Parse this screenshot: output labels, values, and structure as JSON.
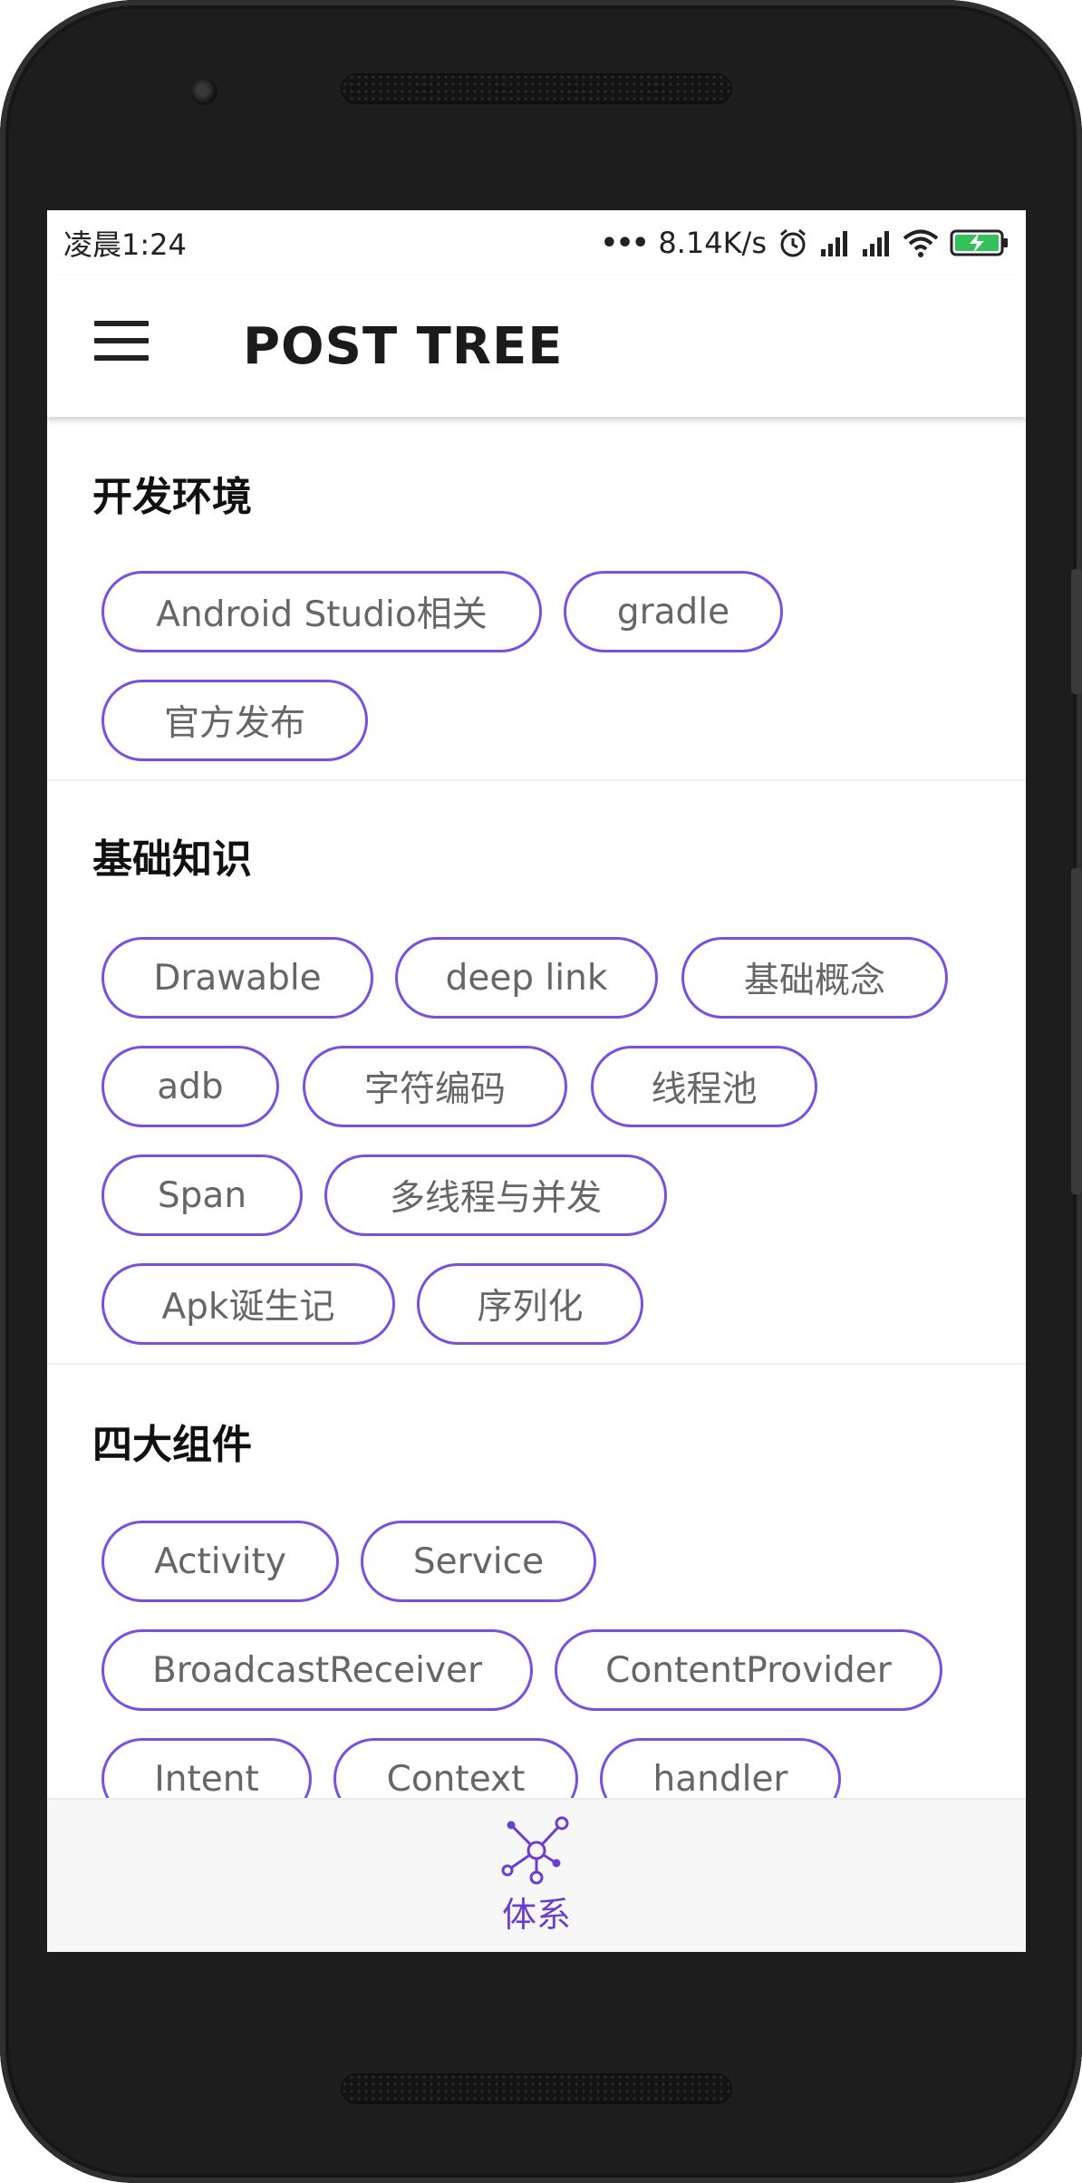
{
  "status_bar": {
    "time": "凌晨1:24",
    "dots": "•••",
    "network_speed": "8.14K/s"
  },
  "app_bar": {
    "title": "POST TREE"
  },
  "sections": [
    {
      "title": "开发环境",
      "tags": [
        "Android Studio相关",
        "gradle",
        "官方发布"
      ]
    },
    {
      "title": "基础知识",
      "tags": [
        "Drawable",
        "deep link",
        "基础概念",
        "adb",
        "字符编码",
        "线程池",
        "Span",
        "多线程与并发",
        "Apk诞生记",
        "序列化"
      ]
    },
    {
      "title": "四大组件",
      "tags": [
        "Activity",
        "Service",
        "BroadcastReceiver",
        "ContentProvider",
        "Intent",
        "Context",
        "handler"
      ]
    }
  ],
  "bottom_nav": {
    "label": "体系",
    "icon": "network-tree-icon"
  },
  "colors": {
    "accent": "#7b4fe0",
    "nav_accent": "#6a3fd0",
    "frame": "#1d1d1d"
  }
}
